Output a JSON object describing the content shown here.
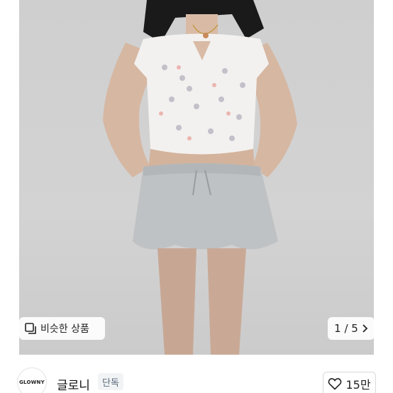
{
  "gallery": {
    "similar_label": "비슷한 상품",
    "pager_label": "1 / 5"
  },
  "shop": {
    "logo_text": "GLOWNY",
    "name": "글로니",
    "badge": "단독"
  },
  "like": {
    "count_label": "15만"
  }
}
